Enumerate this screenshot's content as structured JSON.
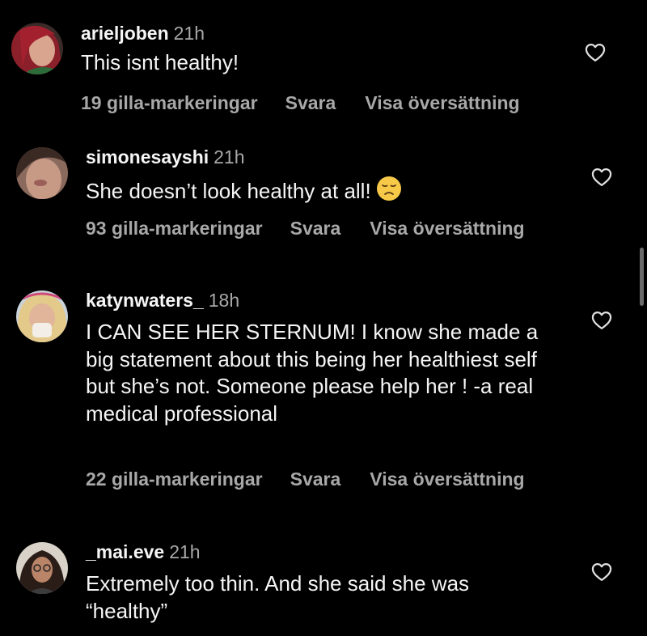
{
  "comments": [
    {
      "username": "arieljoben",
      "time": "21h",
      "text": "This isnt healthy!",
      "likes": "19 gilla-markeringar",
      "reply": "Svara",
      "translate": "Visa översättning"
    },
    {
      "username": "simonesayshi",
      "time": "21h",
      "text": "She doesn’t look healthy at all!",
      "emoji": "disappointed-face-emoji",
      "likes": "93 gilla-markeringar",
      "reply": "Svara",
      "translate": "Visa översättning"
    },
    {
      "username": "katynwaters_",
      "time": "18h",
      "text": "I CAN SEE HER STERNUM! I know she made a big statement about this being her healthiest self but she’s not. Someone please help her ! -a real medical professional",
      "likes": "22 gilla-markeringar",
      "reply": "Svara",
      "translate": "Visa översättning"
    },
    {
      "username": "_mai.eve",
      "time": "21h",
      "text": "Extremely too thin. And she said she was “healthy”"
    }
  ],
  "colors": {
    "background": "#000000",
    "primary_text": "#f5f5f5",
    "secondary_text": "#a8a8a8",
    "emoji_face": "#f7c948"
  },
  "icons": {
    "like": "heart-outline-icon"
  }
}
